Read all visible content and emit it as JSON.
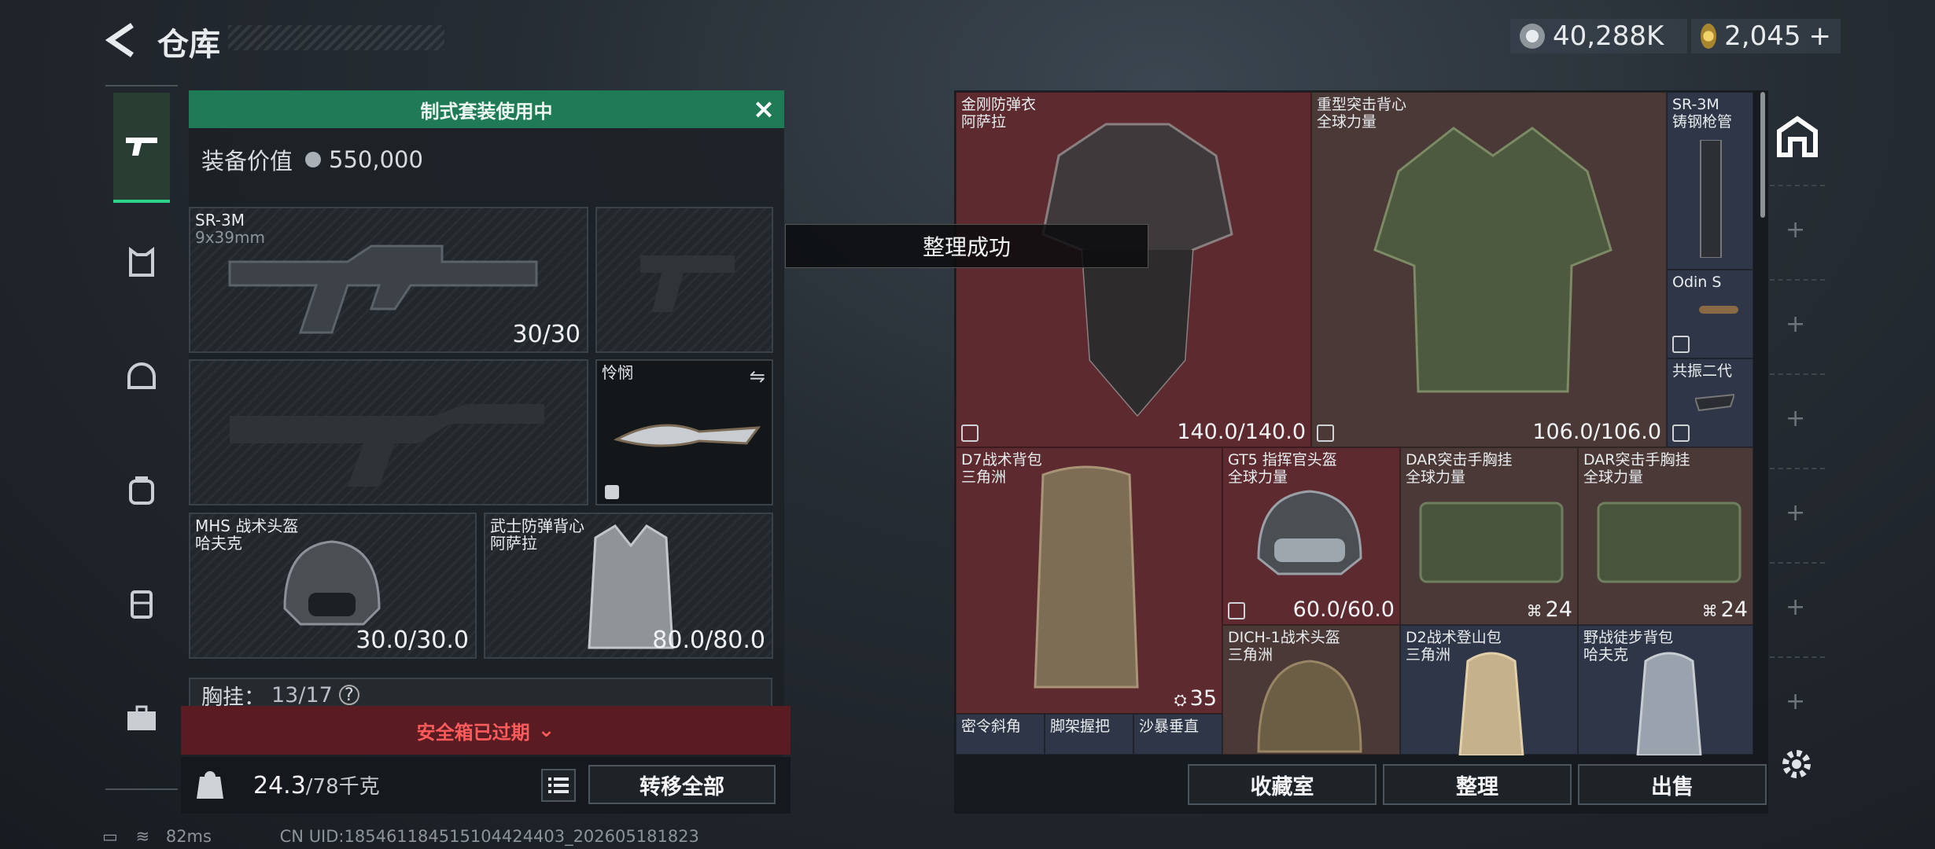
{
  "header": {
    "title": "仓库",
    "currency1": "40,288K",
    "currency2": "2,045"
  },
  "loadout": {
    "banner": "制式套装使用中",
    "value_label": "装备价值",
    "value": "550,000",
    "primary": {
      "name": "SR-3M",
      "ammo": "9x39mm",
      "count": "30/30"
    },
    "melee": {
      "name": "怜悯"
    },
    "helmet": {
      "name": "MHS 战术头盔",
      "brand": "哈夫克",
      "dur": "30.0/30.0"
    },
    "armor": {
      "name": "武士防弹背心",
      "brand": "阿萨拉",
      "dur": "80.0/80.0"
    },
    "chest_label": "胸挂：",
    "chest_value": "13/17",
    "chest_help": "?",
    "expired": "安全箱已过期",
    "weight": "24.3",
    "weight_max": "/78千克",
    "transfer_label": "转移全部"
  },
  "toast": "整理成功",
  "stash": {
    "items": [
      {
        "name": "金刚防弹衣",
        "brand": "阿萨拉",
        "num": "140.0/140.0"
      },
      {
        "name": "重型突击背心",
        "brand": "全球力量",
        "num": "106.0/106.0"
      },
      {
        "name": "SR-3M",
        "brand": "铸钢枪管"
      },
      {
        "name": "Odin S"
      },
      {
        "name": "共振二代"
      },
      {
        "name": "D7战术背包",
        "brand": "三角洲",
        "num": "35"
      },
      {
        "name": "GT5 指挥官头盔",
        "brand": "全球力量",
        "num": "60.0/60.0"
      },
      {
        "name": "DAR突击手胸挂",
        "brand": "全球力量",
        "num": "24"
      },
      {
        "name": "DAR突击手胸挂",
        "brand": "全球力量",
        "num": "24"
      },
      {
        "name": "DICH-1战术头盔",
        "brand": "三角洲"
      },
      {
        "name": "D2战术登山包",
        "brand": "三角洲"
      },
      {
        "name": "野战徒步背包",
        "brand": "哈夫克"
      },
      {
        "name": "密令斜角"
      },
      {
        "name": "脚架握把"
      },
      {
        "name": "沙暴垂直"
      }
    ],
    "btn_vault": "收藏室",
    "btn_sort": "整理",
    "btn_sell": "出售"
  },
  "status": {
    "ping": "82ms",
    "uid": "CN UID:185461184515104424403_202605181823"
  }
}
